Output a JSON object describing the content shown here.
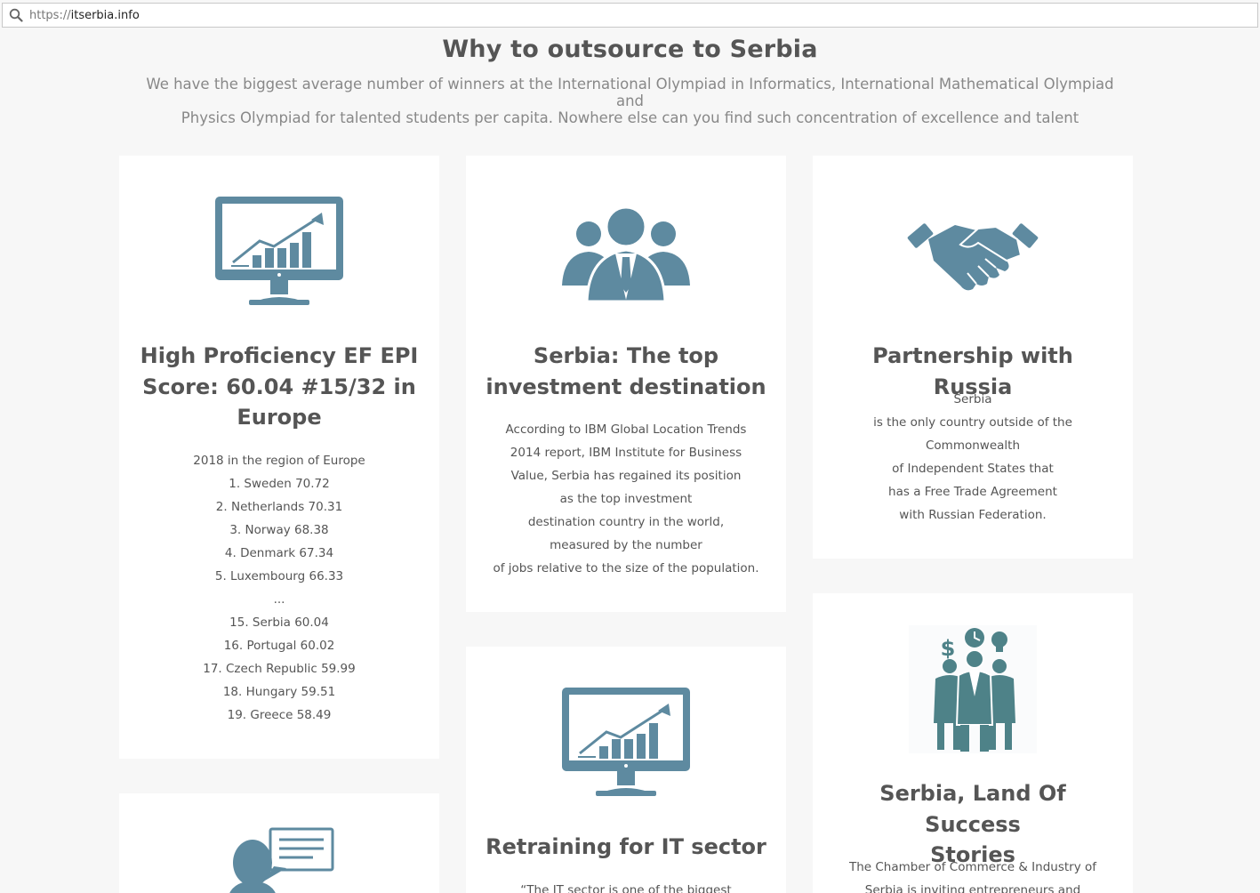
{
  "browser": {
    "url_scheme": "https://",
    "url_host": "itserbia.info"
  },
  "section": {
    "title": "Why to outsource to Serbia",
    "subtitle_line1": "We have the biggest average number of winners at the International Olympiad in Informatics, International Mathematical Olympiad and",
    "subtitle_line2": "Physics Olympiad for talented students per capita. Nowhere else can you find such concentration of excellence and talent"
  },
  "colors": {
    "icon": "#5e8aa0",
    "background": "#f7f7f7",
    "card": "#ffffff"
  },
  "cards": [
    {
      "icon": "monitor-growth-chart-icon",
      "title_lines": [
        "High Proficiency EF EPI",
        "Score: 60.04 #15/32 in",
        "Europe"
      ],
      "lines": [
        "2018 in the region of Europe",
        "1. Sweden 70.72",
        "2. Netherlands 70.31",
        "3. Norway 68.38",
        "4. Denmark 67.34",
        "5. Luxembourg 66.33",
        "...",
        "15. Serbia 60.04",
        "16. Portugal 60.02",
        "17. Czech Republic 59.99",
        "18. Hungary 59.51",
        "19. Greece 58.49"
      ]
    },
    {
      "icon": "business-team-icon",
      "title_lines": [
        "Serbia: The top",
        "investment destination"
      ],
      "lines": [
        "According to IBM Global Location Trends",
        "2014 report, IBM Institute for Business",
        "Value, Serbia has regained its position",
        "as the top investment",
        "destination country in the world,",
        "measured by the number",
        "of jobs relative to the size of the population."
      ]
    },
    {
      "icon": "handshake-icon",
      "title_lines": [
        "Partnership with Russia"
      ],
      "lines": [
        "Serbia",
        "is the only country outside of the",
        "Commonwealth",
        "of Independent States that",
        "has a Free Trade Agreement",
        "with Russian Federation."
      ]
    },
    {
      "icon": "monitor-growth-chart-icon",
      "title_lines": [
        "Retraining for IT sector"
      ],
      "lines": [
        "“The IT sector is one of the biggest"
      ]
    },
    {
      "icon": "success-businessmen-icon",
      "title_lines": [
        "Serbia, Land Of Success",
        "Stories"
      ],
      "lines": [
        "The Chamber of Commerce & Industry of",
        "Serbia is inviting entrepreneurs and"
      ]
    },
    {
      "icon": "speaker-chat-icon",
      "title_lines": [],
      "lines": []
    }
  ]
}
